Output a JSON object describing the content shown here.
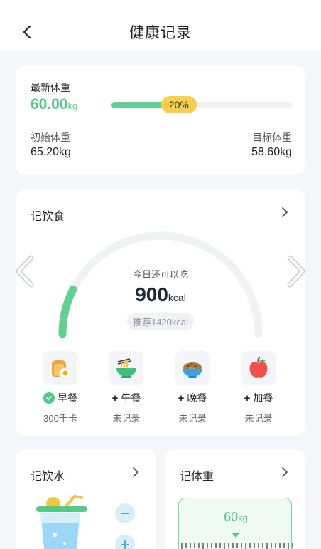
{
  "header": {
    "title": "健康记录",
    "back_icon": "chevron-left-icon"
  },
  "weight": {
    "label": "最新体重",
    "current_value": "60.00",
    "current_unit": "kg",
    "progress_percent": 20,
    "progress_label": "20%",
    "start_label": "初始体重",
    "start_value": "65.20kg",
    "target_label": "目标体重",
    "target_value": "58.60kg"
  },
  "diet": {
    "title": "记饮食",
    "remaining_caption": "今日还可以吃",
    "remaining_value": "900",
    "remaining_unit": "kcal",
    "recommended": "推荐1420kcal",
    "gauge_fraction": 0.15,
    "meals": [
      {
        "name": "早餐",
        "status": "300千卡",
        "recorded": true,
        "icon": "toast-egg-icon"
      },
      {
        "name": "午餐",
        "status": "未记录",
        "recorded": false,
        "icon": "noodle-bowl-icon"
      },
      {
        "name": "晚餐",
        "status": "未记录",
        "recorded": false,
        "icon": "rice-bowl-icon"
      },
      {
        "name": "加餐",
        "status": "未记录",
        "recorded": false,
        "icon": "apple-icon"
      }
    ]
  },
  "water": {
    "title": "记饮水"
  },
  "body_weight": {
    "title": "记体重",
    "scale_value": "60",
    "scale_unit": "kg"
  },
  "colors": {
    "accent_green": "#4fc98a",
    "badge_yellow": "#f8cf4a",
    "water_blue": "#d9eefb"
  }
}
